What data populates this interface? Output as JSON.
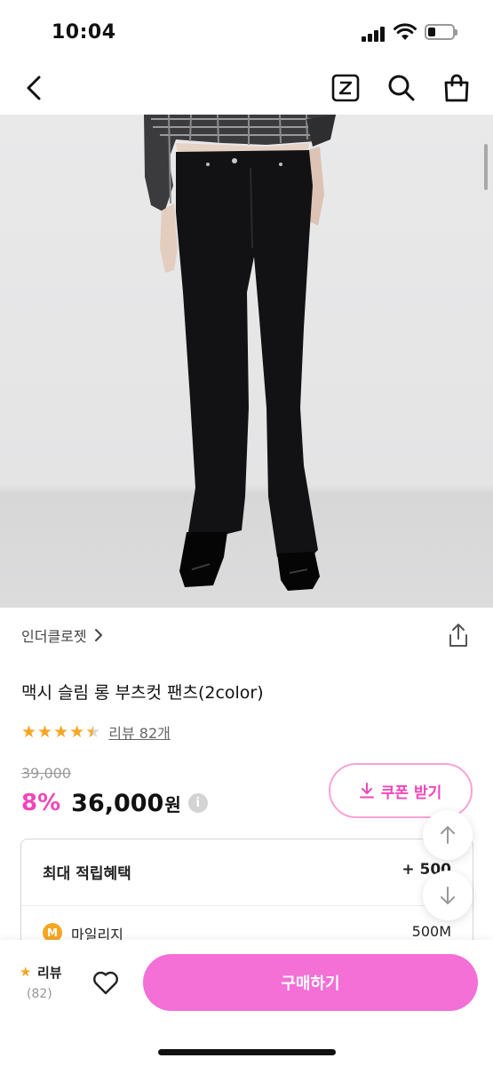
{
  "status_bar": {
    "time": "10:04"
  },
  "nav": {
    "icons": [
      "back-icon",
      "zigzag-z-icon",
      "search-icon",
      "shopping-bag-icon"
    ]
  },
  "product": {
    "brand": "인더클로젯",
    "title": "맥시 슬림 롱 부츠컷 팬츠(2color)",
    "rating": 4.5,
    "review_link": "리뷰 82개",
    "original_price": "39,000",
    "discount": "8%",
    "price": "36,000",
    "currency": "원",
    "info_icon": "i"
  },
  "coupon": {
    "label": "쿠폰 받기"
  },
  "benefits": {
    "header": "최대 적립혜택",
    "header_value": "+ 500",
    "mileage_icon": "M",
    "mileage_label": "마일리지",
    "mileage_value": "500M"
  },
  "bottom_bar": {
    "review_label": "리뷰",
    "review_count": "(82)",
    "buy_label": "구매하기"
  },
  "colors": {
    "accent": "#f046b9",
    "buy_button": "#f46fd6",
    "star": "#f5a623"
  }
}
